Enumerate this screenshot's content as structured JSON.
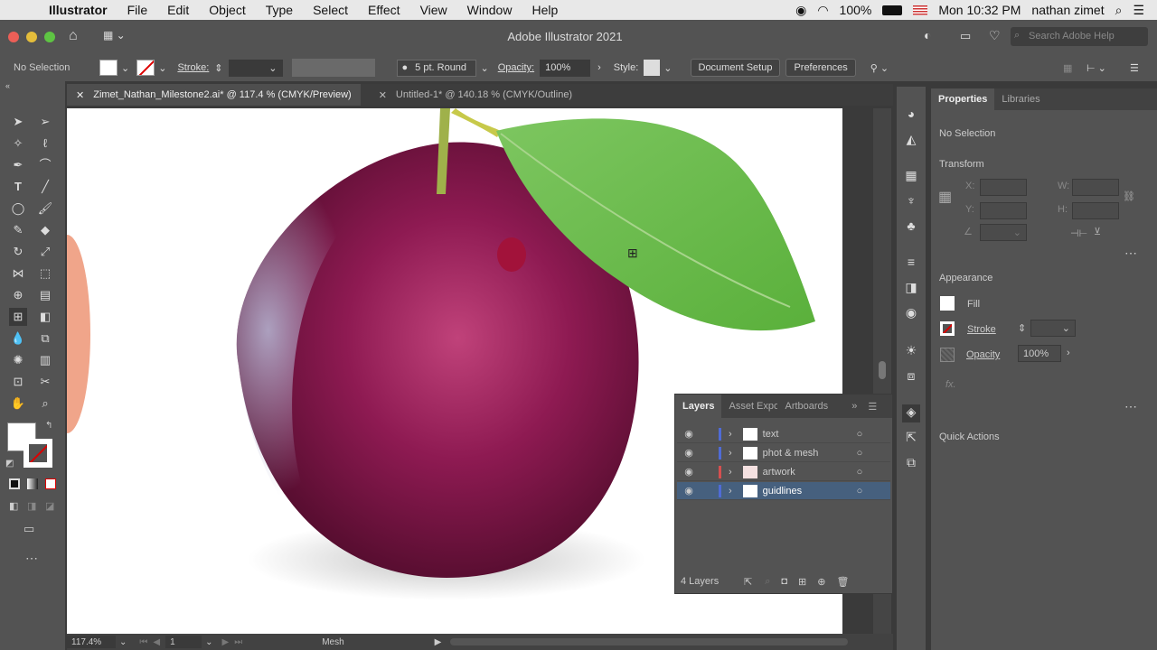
{
  "menubar": {
    "app": "Illustrator",
    "items": [
      "File",
      "Edit",
      "Object",
      "Type",
      "Select",
      "Effect",
      "View",
      "Window",
      "Help"
    ],
    "battery": "100%",
    "datetime": "Mon 10:32 PM",
    "user": "nathan zimet"
  },
  "titlebar": {
    "title": "Adobe Illustrator 2021",
    "search_placeholder": "Search Adobe Help"
  },
  "control": {
    "selection": "No Selection",
    "stroke_label": "Stroke:",
    "brush": "5 pt. Round",
    "opacity_label": "Opacity:",
    "opacity_value": "100%",
    "style_label": "Style:",
    "doc_setup": "Document Setup",
    "preferences": "Preferences"
  },
  "tabs": [
    {
      "label": "Zimet_Nathan_Milestone2.ai* @ 117.4 % (CMYK/Preview)"
    },
    {
      "label": "Untitled-1* @ 140.18 % (CMYK/Outline)"
    }
  ],
  "props": {
    "tab1": "Properties",
    "tab2": "Libraries",
    "no_selection": "No Selection",
    "transform": "Transform",
    "x": "X:",
    "y": "Y:",
    "w": "W:",
    "h": "H:",
    "appearance": "Appearance",
    "fill": "Fill",
    "stroke": "Stroke",
    "opacity": "Opacity",
    "opacity_value": "100%",
    "fx": "fx.",
    "quick_actions": "Quick Actions"
  },
  "layers": {
    "tab1": "Layers",
    "tab2": "Asset Expo",
    "tab3": "Artboards",
    "count": "4 Layers",
    "rows": [
      {
        "name": "text",
        "color": "#4f6bd6"
      },
      {
        "name": "phot & mesh",
        "color": "#4f6bd6"
      },
      {
        "name": "artwork",
        "color": "#d64f4f"
      },
      {
        "name": "guidlines",
        "color": "#4f6bd6"
      }
    ]
  },
  "status": {
    "zoom": "117.4%",
    "artboard": "1",
    "tool": "Mesh"
  }
}
